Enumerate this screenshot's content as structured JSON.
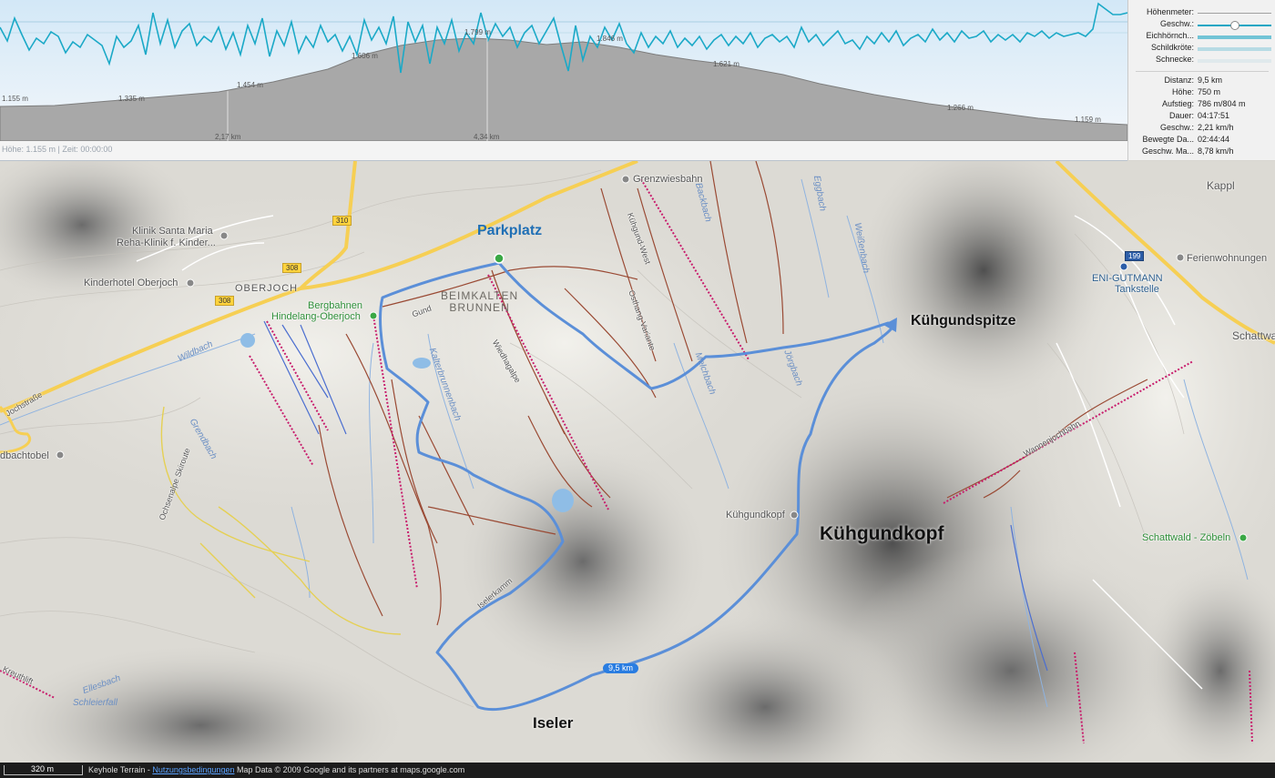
{
  "profile": {
    "status": "Höhe: 1.155 m | Zeit: 00:00:00",
    "km_labels": [
      "2,17 km",
      "4,34 km"
    ],
    "altitude_labels": [
      "1.155 m",
      "1.335 m",
      "1.454 m",
      "1.606 m",
      "1.799 m",
      "1.846 m",
      "1.621 m",
      "1.266 m",
      "1.159 m"
    ]
  },
  "legend": {
    "hoehenmeter": "Höhenmeter:",
    "geschw": "Geschw.:",
    "eichhoernchen": "Eichhörnch...",
    "schildkroete": "Schildkröte:",
    "schnecke": "Schnecke:",
    "colors": {
      "geschw": "#17a6c4",
      "eichhoernchen": "#72c4d6",
      "schildkroete": "#b7dbe4",
      "schnecke": "#e0e9ec"
    }
  },
  "stats": [
    {
      "key": "Distanz:",
      "value": "9,5 km"
    },
    {
      "key": "Höhe:",
      "value": "750 m"
    },
    {
      "key": "Aufstieg:",
      "value": "786 m/804 m"
    },
    {
      "key": "Dauer:",
      "value": "04:17:51"
    },
    {
      "key": "Geschw.:",
      "value": "2,21 km/h"
    },
    {
      "key": "Bewegte Da...",
      "value": "02:44:44"
    },
    {
      "key": "Geschw. Ma...",
      "value": "8,78 km/h"
    }
  ],
  "map": {
    "labels": {
      "parkplatz": "Parkplatz",
      "kuehgundspitze": "Kühgundspitze",
      "kuehgundkopf_big": "Kühgundkopf",
      "iseler": "Iseler",
      "beimkalten": "BEIMKALTEN",
      "brunnen": "BRUNNEN",
      "oberjoch": "OBERJOCH",
      "kappl": "Kappl",
      "schattwald": "Schattwa"
    },
    "pois": {
      "klinik1": "Klinik Santa Maria",
      "klinik2": "Reha-Klinik f. Kinder...",
      "kinderhotel": "Kinderhotel Oberjoch",
      "bergbahnen1": "Bergbahnen",
      "bergbahnen2": "Hindelang-Oberjoch",
      "grenzwiesbahn": "Grenzwiesbahn",
      "kuehgundkopf_poi": "Kühgundkopf",
      "ferienwohnungen": "Ferienwohnungen",
      "eni1": "ENI-GUTMANN",
      "eni2": "Tankstelle",
      "schattwald_zoebeln": "Schattwald - Zöbeln",
      "bachtobel": "dbachtobel",
      "kreuthlift": "Kreuthlift",
      "wannenjochbahn": "Wannenjochbahn",
      "jochstrasse": "Jochstraße",
      "wildbach": "Wildbach",
      "grendbach": "Grendbach",
      "ellesbach": "Ellesbach",
      "schleierfall": "Schleierfall",
      "backbach": "Backbach",
      "eggbach": "Eggbach",
      "weissenbach": "Weißenbach",
      "melchbach": "Melchbach",
      "joerbach": "Jörgbach",
      "kalterbrunnenbach": "Kalterbrunnenbach",
      "ochsenalpe": "Ochsenalpe Skiroute",
      "gund": "Gund",
      "wiedhagalpe": "Wiedhagalpe",
      "kuehgund_west": "Kühgund-West",
      "ostrampe": "Osthang-Variante",
      "isler": "Iselerkamm"
    },
    "distance_badge": "9,5 km",
    "road_shields": [
      "310",
      "308",
      "308",
      "199"
    ]
  },
  "footer": {
    "scale": "320 m",
    "prefix": "Keyhole Terrain -",
    "link": "Nutzungsbedingungen",
    "suffix": "Map Data © 2009 Google and its partners at maps.google.com"
  }
}
